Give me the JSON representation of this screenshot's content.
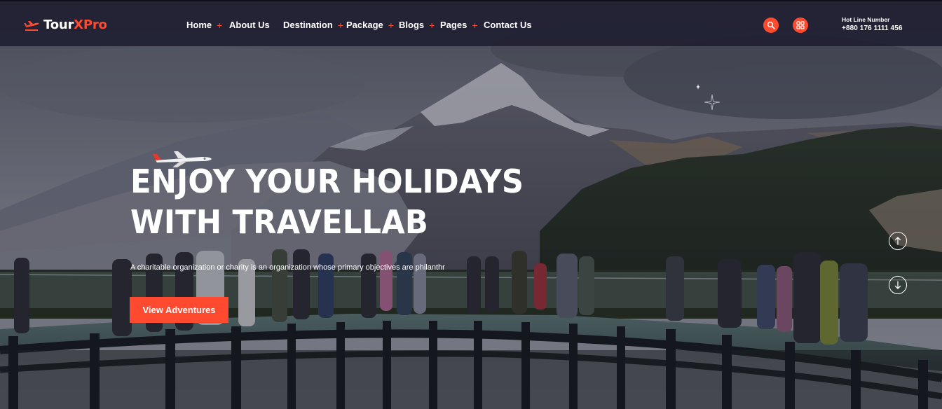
{
  "brand": {
    "name_primary": "Tour",
    "name_accent": "XPro"
  },
  "nav": {
    "items": [
      {
        "label": "Home",
        "has_submenu": true
      },
      {
        "label": "About Us",
        "has_submenu": false
      },
      {
        "label": "Destination",
        "has_submenu": true
      },
      {
        "label": "Package",
        "has_submenu": true
      },
      {
        "label": "Blogs",
        "has_submenu": true
      },
      {
        "label": "Pages",
        "has_submenu": true
      },
      {
        "label": "Contact Us",
        "has_submenu": false
      }
    ],
    "submenu_indicator": "+"
  },
  "header_actions": {
    "search_icon": "search-icon",
    "grid_icon": "grid-icon",
    "hotline_label": "Hot Line Number",
    "hotline_number": "+880 176 1111 456"
  },
  "hero": {
    "title_line1": "ENJOY YOUR HOLIDAYS",
    "title_line2": "WITH TRAVELLAB",
    "description": "A charitable organization or charity is an organization whose primary objectives are philanthr",
    "cta_label": "View Adventures"
  },
  "slider": {
    "up_icon": "arrow-up-icon",
    "down_icon": "arrow-down-icon"
  },
  "colors": {
    "accent": "#ff4a2f",
    "header_bg": "#1e1e30",
    "text": "#ffffff"
  }
}
